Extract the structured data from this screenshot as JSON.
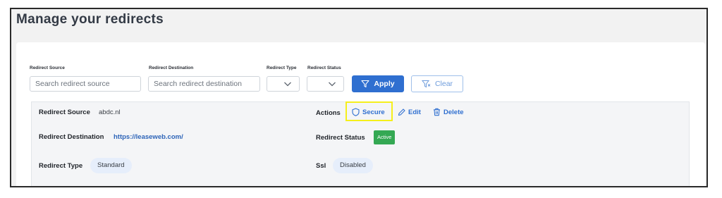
{
  "page": {
    "title": "Manage your redirects"
  },
  "filters": {
    "source": {
      "label": "Redirect Source",
      "placeholder": "Search redirect source"
    },
    "destination": {
      "label": "Redirect Destination",
      "placeholder": "Search redirect destination"
    },
    "type": {
      "label": "Redirect Type",
      "value": ""
    },
    "status": {
      "label": "Redirect Status",
      "value": ""
    },
    "apply_label": "Apply",
    "clear_label": "Clear"
  },
  "result": {
    "source_key": "Redirect Source",
    "source_value": "abdc.nl",
    "destination_key": "Redirect Destination",
    "destination_value": "https://leaseweb.com/",
    "type_key": "Redirect Type",
    "type_value": "Standard",
    "actions_key": "Actions",
    "actions": {
      "secure": "Secure",
      "edit": "Edit",
      "delete": "Delete"
    },
    "status_key": "Redirect Status",
    "status_value": "Active",
    "ssl_key": "Ssl",
    "ssl_value": "Disabled"
  },
  "colors": {
    "primary": "#2f6fd0",
    "active": "#34a853",
    "highlight": "#f5ef1b",
    "pill": "#e6eefb"
  },
  "icons": {
    "apply": "filter-icon",
    "clear": "filter-clear-icon",
    "secure": "shield-icon",
    "edit": "pencil-icon",
    "delete": "trash-icon",
    "select": "chevron-down-icon"
  }
}
